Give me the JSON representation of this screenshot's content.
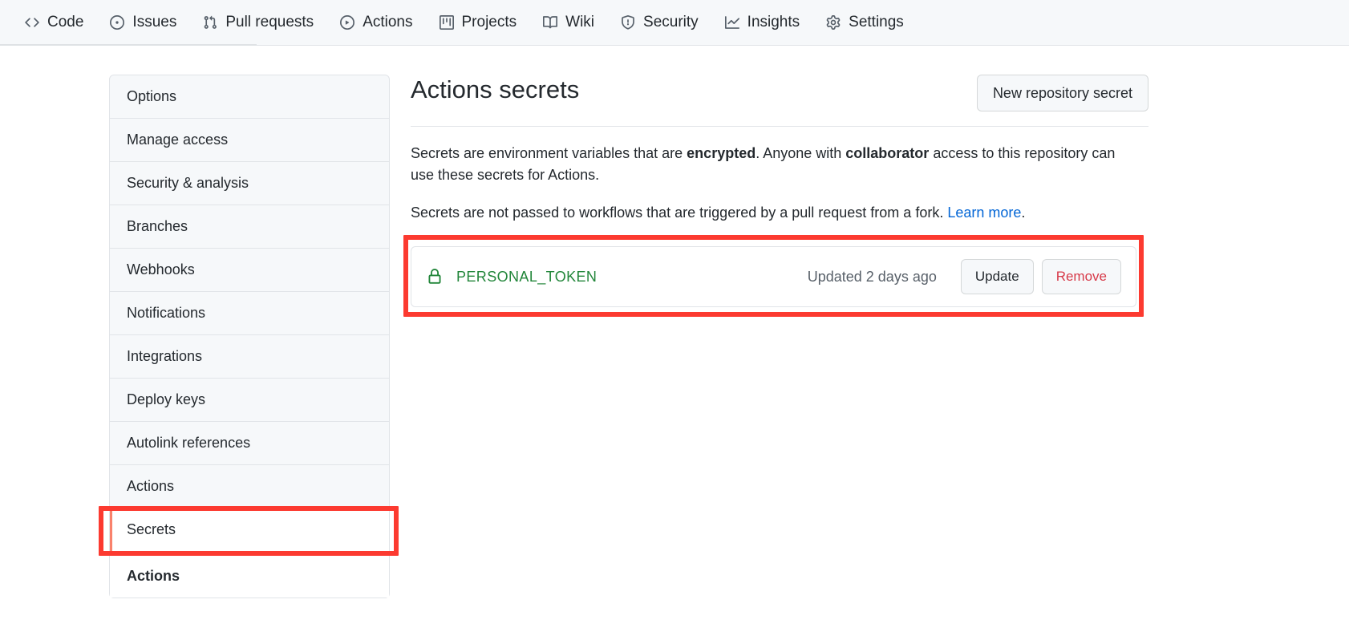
{
  "repo_nav": {
    "items": [
      {
        "label": "Code",
        "icon": "code-icon"
      },
      {
        "label": "Issues",
        "icon": "issue-opened-icon"
      },
      {
        "label": "Pull requests",
        "icon": "git-pull-request-icon"
      },
      {
        "label": "Actions",
        "icon": "play-icon"
      },
      {
        "label": "Projects",
        "icon": "project-icon"
      },
      {
        "label": "Wiki",
        "icon": "book-icon"
      },
      {
        "label": "Security",
        "icon": "shield-icon"
      },
      {
        "label": "Insights",
        "icon": "graph-icon"
      },
      {
        "label": "Settings",
        "icon": "gear-icon"
      }
    ]
  },
  "sidebar": {
    "items": [
      {
        "label": "Options",
        "selected": false
      },
      {
        "label": "Manage access",
        "selected": false
      },
      {
        "label": "Security & analysis",
        "selected": false
      },
      {
        "label": "Branches",
        "selected": false
      },
      {
        "label": "Webhooks",
        "selected": false
      },
      {
        "label": "Notifications",
        "selected": false
      },
      {
        "label": "Integrations",
        "selected": false
      },
      {
        "label": "Deploy keys",
        "selected": false
      },
      {
        "label": "Autolink references",
        "selected": false
      },
      {
        "label": "Actions",
        "selected": false
      },
      {
        "label": "Secrets",
        "selected": true
      }
    ],
    "section_heading": "Actions"
  },
  "main": {
    "title": "Actions secrets",
    "new_secret_button": "New repository secret",
    "description_1": {
      "part1": "Secrets are environment variables that are ",
      "bold1": "encrypted",
      "part2": ". Anyone with ",
      "bold2": "collaborator",
      "part3": " access to this repository can use these secrets for Actions."
    },
    "description_2": {
      "text": "Secrets are not passed to workflows that are triggered by a pull request from a fork. ",
      "link": "Learn more",
      "suffix": "."
    },
    "secrets": [
      {
        "name": "PERSONAL_TOKEN",
        "updated": "Updated 2 days ago",
        "update_button": "Update",
        "remove_button": "Remove",
        "icon": "lock-icon"
      }
    ]
  },
  "colors": {
    "annotation": "#fc3a30",
    "secret_green": "#22863a",
    "selected_accent": "#f9826c",
    "link": "#0366d6",
    "danger": "#d73a49"
  }
}
